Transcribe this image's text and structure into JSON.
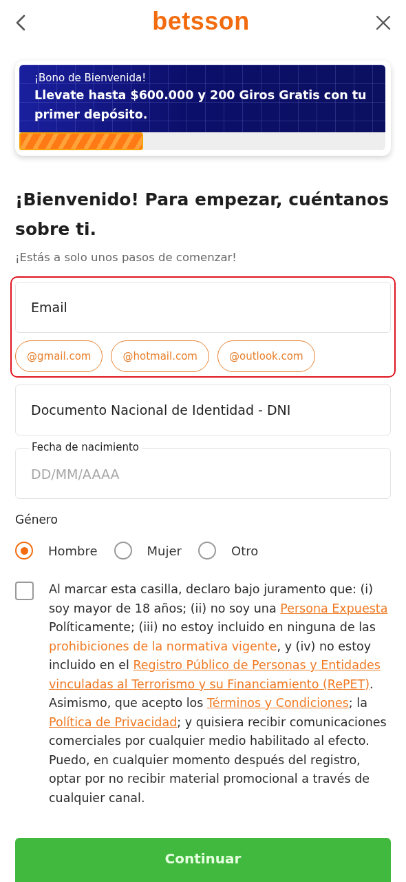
{
  "header": {
    "logo": "betsson"
  },
  "promo": {
    "eyebrow": "¡Bono de Bienvenida!",
    "headline": "Llevate hasta $600.000 y 200 Giros Gratis con tu primer depósito.",
    "level": 0.33
  },
  "heading": "¡Bienvenido! Para empezar, cuéntanos sobre ti.",
  "subtitle": "¡Estás a solo unos pasos de comenzar!",
  "email": {
    "placeholder": "Email",
    "error": true,
    "suggestions": [
      "@gmail.com",
      "@hotmail.com",
      "@outlook.com"
    ]
  },
  "dni": {
    "placeholder": "Documento Nacional de Identidad - DNI"
  },
  "birthdate": {
    "label": "Fecha de nacimiento",
    "placeholder": "DD/MM/AAAA"
  },
  "gender": {
    "label": "Género",
    "options": [
      {
        "label": "Hombre",
        "selected": true
      },
      {
        "label": "Mujer",
        "selected": false
      },
      {
        "label": "Otro",
        "selected": false
      }
    ]
  },
  "consent": {
    "checked": false,
    "segments": [
      {
        "kind": "text",
        "text": "Al marcar esta casilla, declaro bajo juramento que: (i) soy mayor de 18 años; (ii) no soy una "
      },
      {
        "kind": "link",
        "text": "Persona Expuesta",
        "underlined": true
      },
      {
        "kind": "text",
        "text": " Políticamente; (iii) no estoy incluido en ninguna de las "
      },
      {
        "kind": "link",
        "text": "prohibiciones de la normativa vigente",
        "underlined": false
      },
      {
        "kind": "text",
        "text": ", y (iv) no estoy incluido en el "
      },
      {
        "kind": "link",
        "text": "Registro Público de Personas y Entidades",
        "underlined": true
      },
      {
        "kind": "link",
        "text": "vinculadas al Terrorismo y su Financiamiento (RePET)",
        "underlined": true
      },
      {
        "kind": "text",
        "text": ". Asimismo, que acepto los "
      },
      {
        "kind": "link",
        "text": "Términos y Condiciones",
        "underlined": true
      },
      {
        "kind": "text",
        "text": "; la "
      },
      {
        "kind": "link",
        "text": "Política de Privacidad",
        "underlined": true
      },
      {
        "kind": "text",
        "text": "; y quisiera recibir comunicaciones comerciales por cualquier medio habilitado al efecto. Puedo, en cualquier momento después del registro, optar por no recibir material promocional a través de cualquier canal."
      }
    ]
  },
  "continue_button": "Continuar"
}
